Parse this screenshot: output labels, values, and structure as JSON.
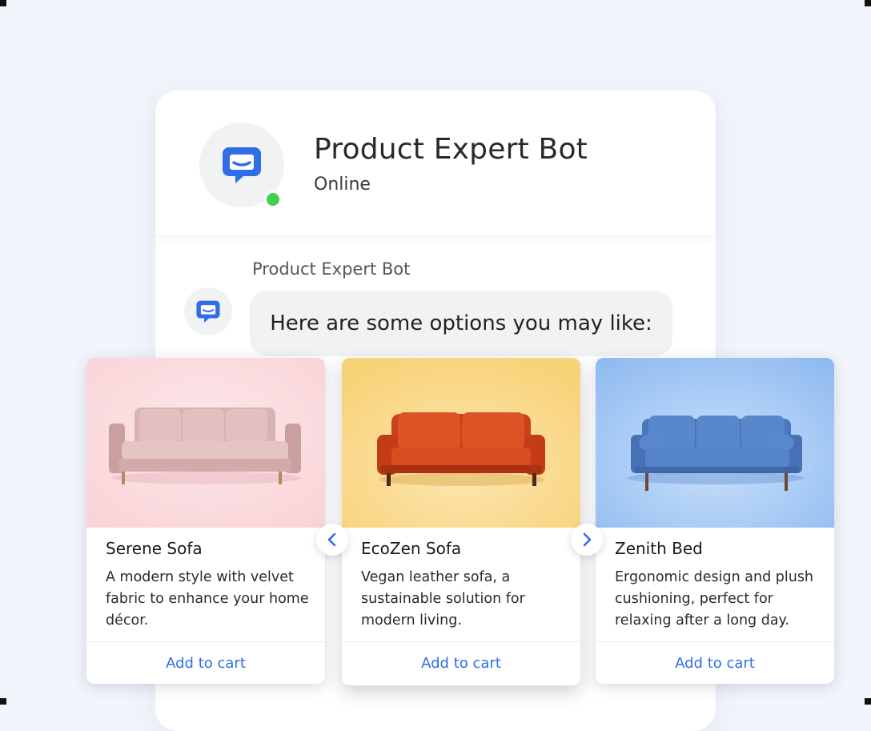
{
  "bot": {
    "name": "Product Expert Bot",
    "status": "Online"
  },
  "message": {
    "sender": "Product Expert Bot",
    "text": "Here are some options you may like:"
  },
  "products": [
    {
      "title": "Serene Sofa",
      "description": "A modern style with velvet fabric to enhance your home décor.",
      "button": "Add to cart"
    },
    {
      "title": "EcoZen Sofa",
      "description": "Vegan leather sofa, a sustainable solution for modern living.",
      "button": "Add to cart"
    },
    {
      "title": "Zenith Bed",
      "description": "Ergonomic design and plush cushioning, perfect for relaxing after a long day.",
      "button": "Add to cart"
    }
  ],
  "icons": {
    "bot_avatar": "chat-bubble-icon",
    "prev": "chevron-left-icon",
    "next": "chevron-right-icon"
  },
  "colors": {
    "accent": "#2f6ee8",
    "online": "#3fd14a",
    "card1_bg": "#fbdde0",
    "card2_bg": "#fbd98a",
    "card3_bg": "#a9cdf5"
  }
}
